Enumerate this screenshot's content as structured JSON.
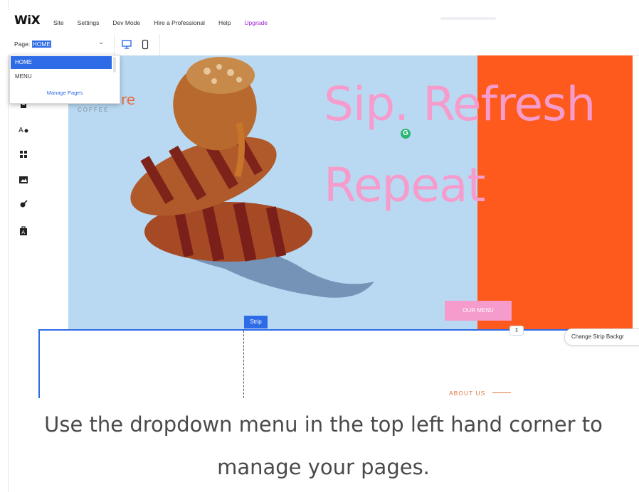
{
  "editor": {
    "logo": "WiX",
    "menu": [
      "Site",
      "Settings",
      "Dev Mode",
      "Hire a Professional",
      "Help"
    ],
    "upgrade": "Upgrade",
    "page_label": "Page:",
    "page_value": "HOME"
  },
  "dropdown": {
    "items": [
      "HOME",
      "MENU"
    ],
    "manage": "Manage Pages"
  },
  "site": {
    "brand_fragment": "re",
    "brand_sub": "COFFEE",
    "headline_1": "Sip. Refresh",
    "headline_2": "Repeat",
    "cta": "OUR MENU",
    "about": "ABOUT US"
  },
  "strip": {
    "tag": "Strip",
    "change_bg": "Change Strip Backgr"
  },
  "caption": {
    "text": "Use the dropdown menu in the top left hand corner to manage your pages."
  },
  "colors": {
    "accent": "#2e6be6",
    "hero_blue": "#b9d9f2",
    "hero_orange": "#fe5a1d",
    "pink": "#f59ccd",
    "upgrade_purple": "#9a27d5"
  }
}
